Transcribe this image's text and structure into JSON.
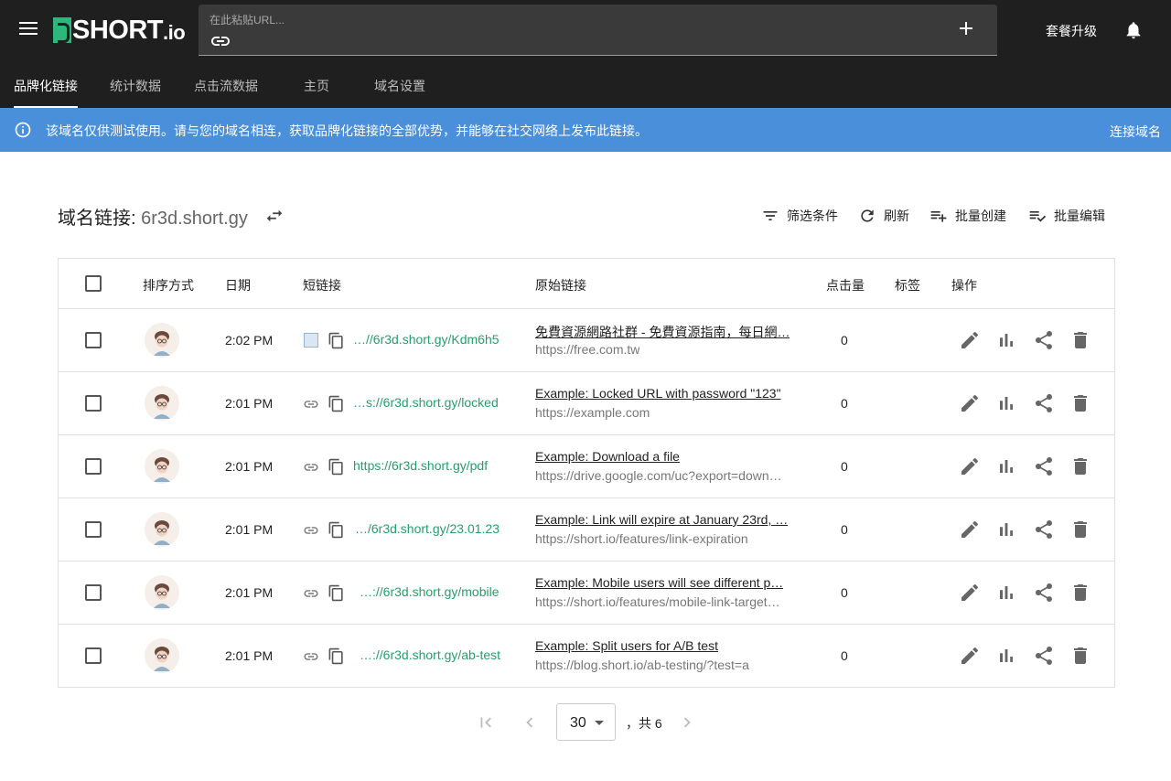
{
  "brand": {
    "logo_main": "SHORT",
    "logo_suffix": ".io"
  },
  "search": {
    "placeholder": "在此粘贴URL..."
  },
  "header": {
    "upgrade_label": "套餐升级"
  },
  "nav": {
    "tabs": [
      {
        "label": "品牌化链接",
        "active": true
      },
      {
        "label": "统计数据"
      },
      {
        "label": "点击流数据"
      },
      {
        "label": "主页"
      },
      {
        "label": "域名设置"
      }
    ]
  },
  "banner": {
    "text": "该域名仅供测试使用。请与您的域名相连，获取品牌化链接的全部优势，并能够在社交网络上发布此链接。",
    "action_label": "连接域名",
    "color": "#4a8fd9"
  },
  "domain": {
    "prefix": "域名链接: ",
    "name": "6r3d.short.gy"
  },
  "toolbar": {
    "filter_label": "筛选条件",
    "refresh_label": "刷新",
    "bulk_create_label": "批量创建",
    "bulk_edit_label": "批量编辑"
  },
  "table": {
    "columns": {
      "sort": "排序方式",
      "date": "日期",
      "short": "短链接",
      "original": "原始链接",
      "clicks": "点击量",
      "tags": "标签",
      "actions": "操作"
    },
    "rows": [
      {
        "date": "2:02 PM",
        "short": "…//6r3d.short.gy/Kdm6h5",
        "title": "免費資源網路社群 - 免費資源指南，每日網…",
        "url": "https://free.com.tw",
        "clicks": "0",
        "icon": "favicon"
      },
      {
        "date": "2:01 PM",
        "short": "…s://6r3d.short.gy/locked",
        "title": "Example: Locked URL with password \"123\"",
        "url": "https://example.com",
        "clicks": "0",
        "icon": "link-icon"
      },
      {
        "date": "2:01 PM",
        "short": "https://6r3d.short.gy/pdf",
        "title": "Example: Download a file",
        "url": "https://drive.google.com/uc?export=down…",
        "clicks": "0",
        "icon": "link-icon"
      },
      {
        "date": "2:01 PM",
        "short": "…/6r3d.short.gy/23.01.23",
        "title": "Example: Link will expire at January 23rd, …",
        "url": "https://short.io/features/link-expiration",
        "clicks": "0",
        "icon": "link-icon"
      },
      {
        "date": "2:01 PM",
        "short": "…://6r3d.short.gy/mobile",
        "title": "Example: Mobile users will see different p…",
        "url": "https://short.io/features/mobile-link-target…",
        "clicks": "0",
        "icon": "link-icon"
      },
      {
        "date": "2:01 PM",
        "short": "…://6r3d.short.gy/ab-test",
        "title": "Example: Split users for A/B test",
        "url": "https://blog.short.io/ab-testing/?test=a",
        "clicks": "0",
        "icon": "link-icon"
      }
    ]
  },
  "pagination": {
    "page_size": "30",
    "total_text": "，共 6"
  },
  "colors": {
    "topbar": "#1f1f1f",
    "accent_green": "#25a06a",
    "link_green": "#2eb67d"
  }
}
